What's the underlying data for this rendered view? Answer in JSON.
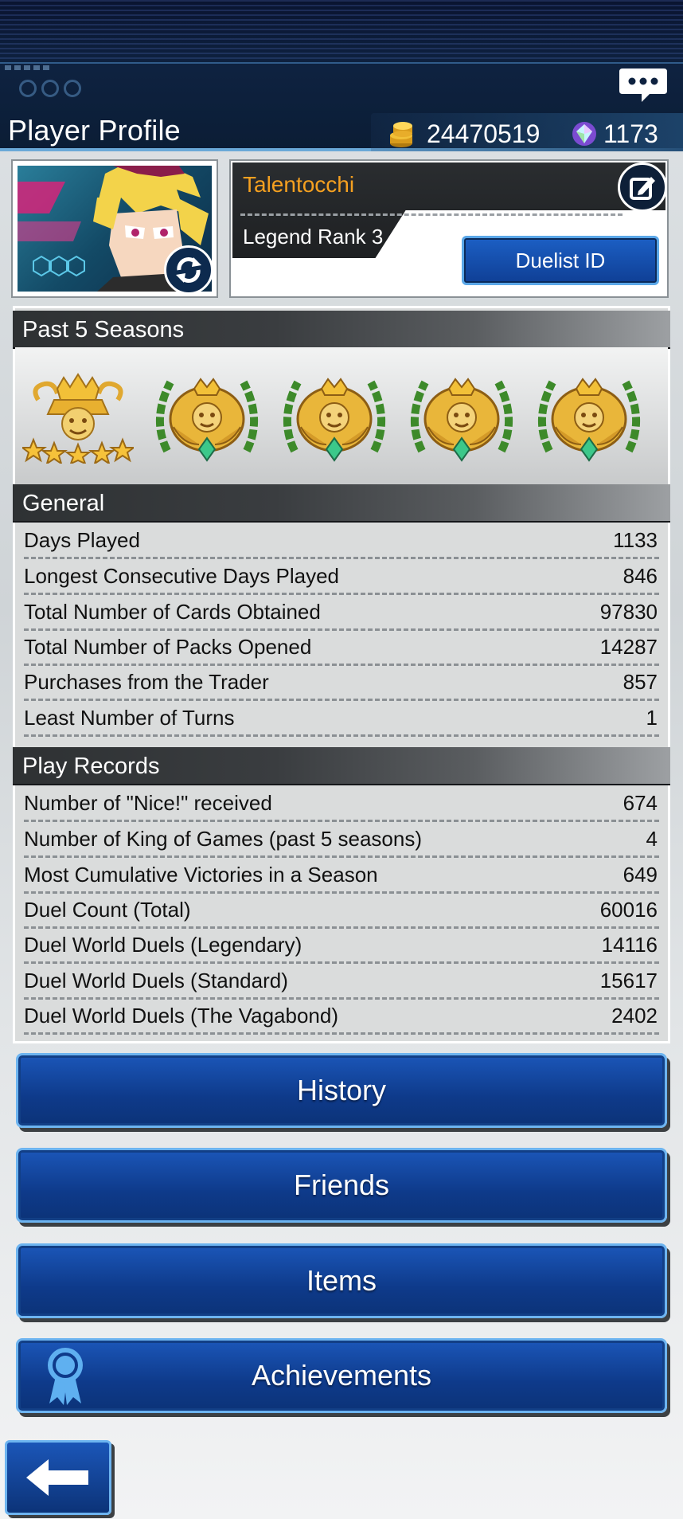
{
  "header": {
    "title": "Player Profile",
    "gold": "24470519",
    "gems": "1173"
  },
  "profile": {
    "name": "Talentocchi",
    "rank": "Legend Rank 3",
    "duelist_id_label": "Duelist ID"
  },
  "seasons": {
    "title": "Past 5 Seasons"
  },
  "general": {
    "title": "General",
    "rows": [
      {
        "label": "Days Played",
        "value": "1133"
      },
      {
        "label": "Longest Consecutive Days Played",
        "value": "846"
      },
      {
        "label": "Total Number of Cards Obtained",
        "value": "97830"
      },
      {
        "label": "Total Number of Packs Opened",
        "value": "14287"
      },
      {
        "label": "Purchases from the Trader",
        "value": "857"
      },
      {
        "label": "Least Number of Turns",
        "value": "1"
      }
    ]
  },
  "play_records": {
    "title": "Play Records",
    "rows": [
      {
        "label": "Number of \"Nice!\" received",
        "value": "674"
      },
      {
        "label": "Number of King of Games (past 5 seasons)",
        "value": "4"
      },
      {
        "label": "Most Cumulative Victories in a Season",
        "value": "649"
      },
      {
        "label": "Duel Count (Total)",
        "value": "60016"
      },
      {
        "label": "Duel World Duels (Legendary)",
        "value": "14116"
      },
      {
        "label": "Duel World Duels (Standard)",
        "value": "15617"
      },
      {
        "label": "Duel World Duels (The Vagabond)",
        "value": "2402"
      }
    ]
  },
  "buttons": {
    "history": "History",
    "friends": "Friends",
    "items": "Items",
    "achievements": "Achievements"
  },
  "colors": {
    "accent_orange": "#f5a020",
    "button_blue": "#1b56b8",
    "button_border": "#6db4f0",
    "header_dark": "#0e2240"
  }
}
